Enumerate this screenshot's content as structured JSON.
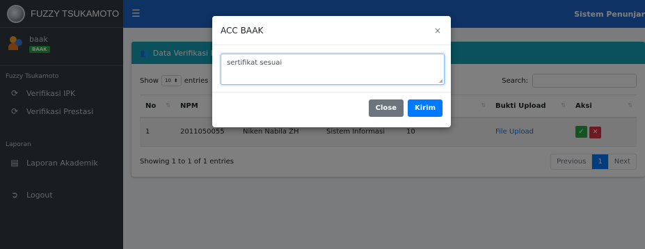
{
  "brand": {
    "title": "FUZZY TSUKAMOTO"
  },
  "user": {
    "name": "baak",
    "badge": "BAAK"
  },
  "sidebar": {
    "section1": "Fuzzy Tsukamoto",
    "items1": [
      {
        "label": "Verifikasi IPK"
      },
      {
        "label": "Verifikasi Prestasi"
      }
    ],
    "section2": "Laporan",
    "items2": [
      {
        "label": "Laporan Akademik"
      }
    ],
    "logout": "Logout"
  },
  "navbar": {
    "right_text": "Sistem Penunjar"
  },
  "card": {
    "title": "Data Verifikasi Pr",
    "show_label": "Show",
    "entries_value": "10",
    "entries_label": "entries",
    "search_label": "Search:",
    "columns": [
      "No",
      "NPM",
      "",
      "",
      "tasi",
      "Bukti Upload",
      "Aksi"
    ],
    "rows": [
      {
        "no": "1",
        "npm": "2011050055",
        "nama": "Niken Nabila ZH",
        "prodi": "Sistem Informasi",
        "nilai": "10",
        "bukti": "File Upload"
      }
    ],
    "footer_info": "Showing 1 to 1 of 1 entries",
    "pagination": {
      "prev": "Previous",
      "current": "1",
      "next": "Next"
    }
  },
  "modal": {
    "title": "ACC BAAK",
    "close_symbol": "×",
    "textarea_value": "sertifikat sesuai",
    "close_label": "Close",
    "submit_label": "Kirim"
  },
  "colors": {
    "navbar": "#1e64c8",
    "sidebar": "#343a40",
    "card_header": "#17a2b8",
    "primary": "#007bff",
    "success": "#28a745",
    "danger": "#dc3545"
  }
}
